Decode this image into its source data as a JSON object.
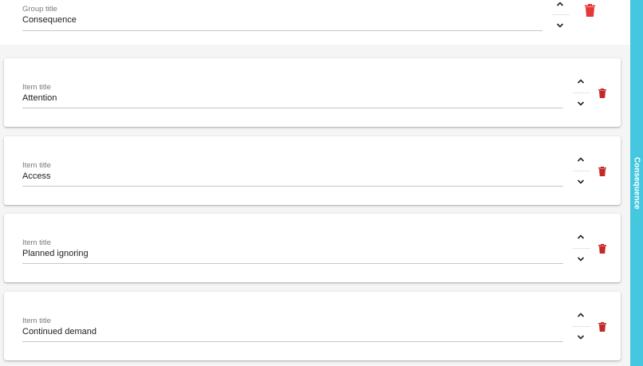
{
  "group": {
    "label": "Group title",
    "value": "Consequence"
  },
  "items": [
    {
      "label": "Item title",
      "value": "Attention"
    },
    {
      "label": "Item title",
      "value": "Access"
    },
    {
      "label": "Item title",
      "value": "Planned ignoring"
    },
    {
      "label": "Item title",
      "value": "Continued demand"
    }
  ],
  "side_tab": {
    "label": "Consequence"
  },
  "icons": {
    "move_up": "chevron-up-icon",
    "move_down": "chevron-down-icon",
    "delete": "trash-icon"
  },
  "colors": {
    "accent": "#45c7df",
    "delete": "#c62828",
    "delete_header": "#e53935"
  }
}
